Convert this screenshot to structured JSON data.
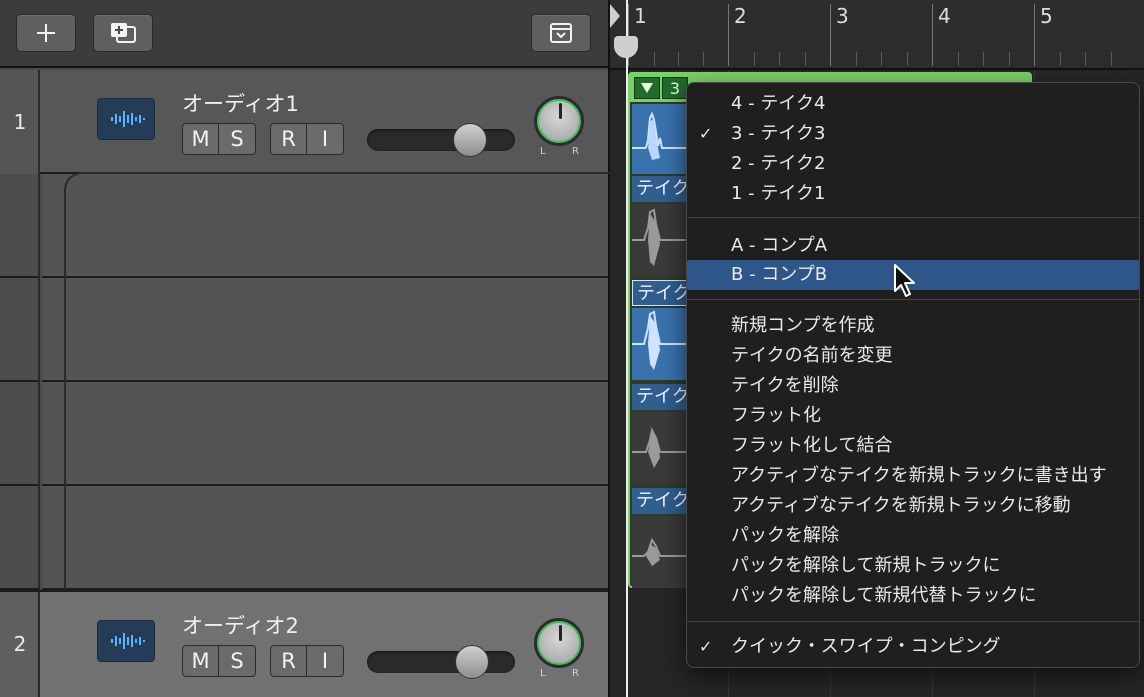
{
  "toolbar": {
    "add_track_icon": "plus-icon",
    "new_track_duplicate_icon": "duplicate-track-icon",
    "global_tracks_icon": "chevron-box-icon"
  },
  "tracks": [
    {
      "number": "1",
      "name": "オーディオ1",
      "mute": "M",
      "solo": "S",
      "record": "R",
      "input": "I",
      "pan_left": "L",
      "pan_right": "R",
      "volume": 0.7
    },
    {
      "number": "2",
      "name": "オーディオ2",
      "mute": "M",
      "solo": "S",
      "record": "R",
      "input": "I",
      "pan_left": "L",
      "pan_right": "R",
      "volume": 0.7
    }
  ],
  "ruler": {
    "bars": [
      "1",
      "2",
      "3",
      "4",
      "5"
    ]
  },
  "take_folder": {
    "header_number": "3",
    "take_label": "テイク"
  },
  "context_menu": {
    "takes": [
      {
        "label": "4 - テイク4",
        "checked": false
      },
      {
        "label": "3 - テイク3",
        "checked": true
      },
      {
        "label": "2 - テイク2",
        "checked": false
      },
      {
        "label": "1 - テイク1",
        "checked": false
      }
    ],
    "comps": [
      {
        "label": "A - コンプA",
        "highlighted": false
      },
      {
        "label": "B - コンプB",
        "highlighted": true
      }
    ],
    "actions": [
      "新規コンプを作成",
      "テイクの名前を変更",
      "テイクを削除",
      "フラット化",
      "フラット化して結合",
      "アクティブなテイクを新規トラックに書き出す",
      "アクティブなテイクを新規トラックに移動",
      "パックを解除",
      "パックを解除して新規トラックに",
      "パックを解除して新規代替トラックに"
    ],
    "quick_swipe": {
      "label": "クイック・スワイプ・コンピング",
      "checked": true
    },
    "check_mark": "✓"
  },
  "colors": {
    "take_folder_green": "#7bd169",
    "take_label_blue": "#2f5e8f",
    "menu_highlight": "#2f5688"
  }
}
